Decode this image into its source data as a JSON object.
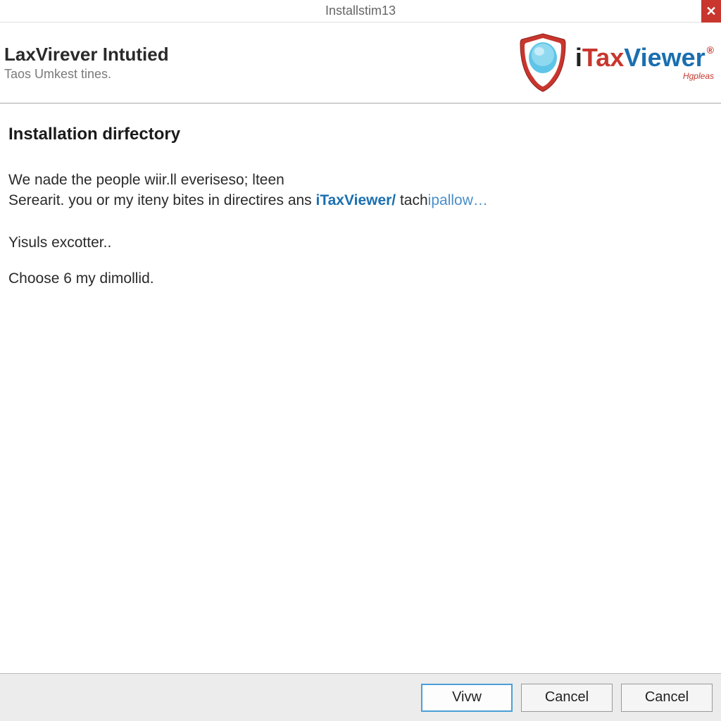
{
  "titlebar": {
    "text": "Installstim13"
  },
  "header": {
    "title": "LaxVirever Intutied",
    "subtitle": "Taos Umkest tines."
  },
  "logo": {
    "prefix": "i",
    "tax": "Tax",
    "viewer": "Viewer",
    "reg": "®",
    "tagline": "Hgpleas"
  },
  "content": {
    "section_title": "Installation dirfectory",
    "line1": "We nade the people wiir.ll everiseso; lteen",
    "line2_pre": "Serearit. you or my iteny bites in directires ans ",
    "line2_link1": "iTaxViewer/",
    "line2_mid": " tach",
    "line2_link2": "ipallow…",
    "line3": "Yisuls excotter..",
    "line4": "Choose 6 my dimollid."
  },
  "footer": {
    "view": "Vivw",
    "cancel1": "Cancel",
    "cancel2": "Cancel"
  }
}
